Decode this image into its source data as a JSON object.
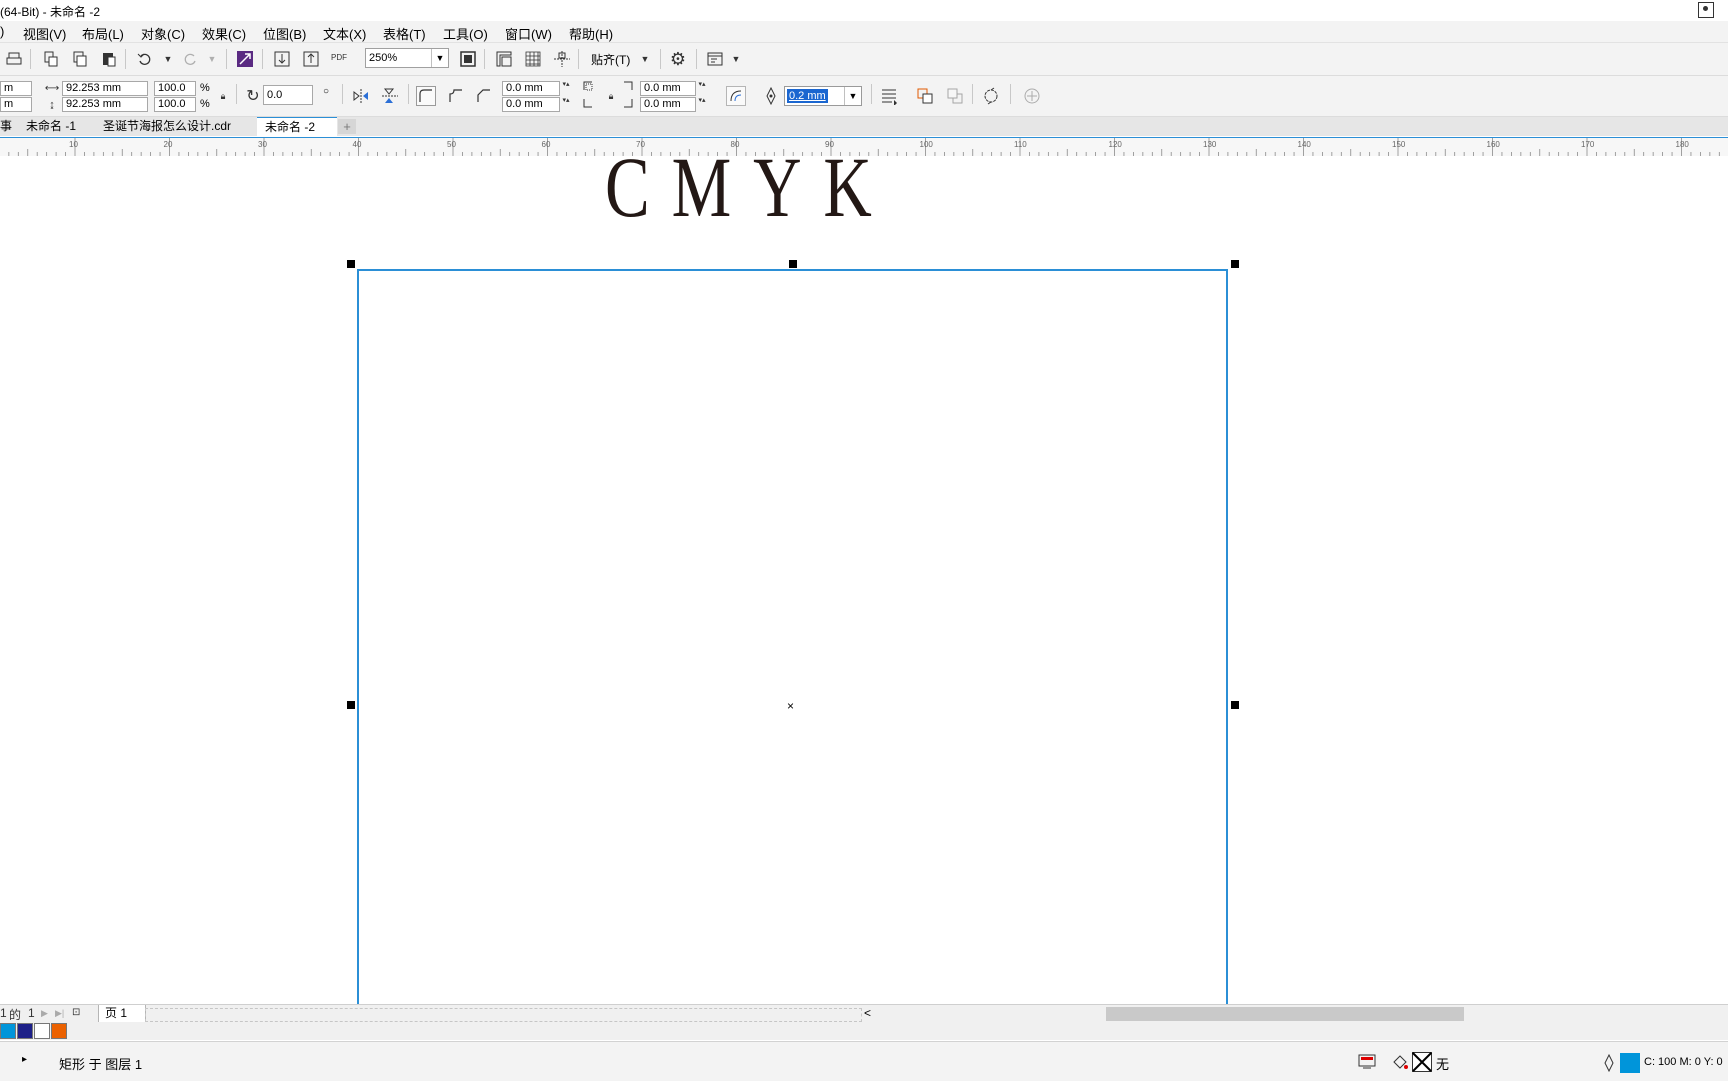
{
  "window": {
    "title": "(64-Bit) - 未命名 -2"
  },
  "menubar": {
    "edge_char": ")",
    "items": [
      {
        "label": "视图(V)"
      },
      {
        "label": "布局(L)"
      },
      {
        "label": "对象(C)"
      },
      {
        "label": "效果(C)"
      },
      {
        "label": "位图(B)"
      },
      {
        "label": "文本(X)"
      },
      {
        "label": "表格(T)"
      },
      {
        "label": "工具(O)"
      },
      {
        "label": "窗口(W)"
      },
      {
        "label": "帮助(H)"
      }
    ]
  },
  "toolbar": {
    "zoom_value": "250%",
    "pdf_label": "PDF",
    "snap_label": "贴齐(T)",
    "icons": [
      "print-icon",
      "cut-icon",
      "copy-icon",
      "paste-icon",
      "undo-icon",
      "redo-icon",
      "corel-connect-icon",
      "import-icon",
      "export-icon",
      "publish-pdf-icon",
      "full-screen-icon",
      "show-rulers-icon",
      "show-grid-icon",
      "show-guidelines-icon",
      "options-gear-icon",
      "app-launcher-icon"
    ]
  },
  "propbar": {
    "x_partial": "m",
    "y_partial": "m",
    "width_value": "92.253 mm",
    "height_value": "92.253 mm",
    "scale_x": "100.0",
    "scale_y": "100.0",
    "percent": "%",
    "rotation_value": "0.0",
    "degree_symbol": "○",
    "corner_top_left": "0.0 mm",
    "corner_bottom_left": "0.0 mm",
    "corner_top_right": "0.0 mm",
    "corner_bottom_right": "0.0 mm",
    "outline_width": "0.2 mm"
  },
  "doc_tabs": {
    "edge_char": "事",
    "tabs": [
      {
        "label": "未命名 -1",
        "active": false
      },
      {
        "label": "圣诞节海报怎么设计.cdr",
        "active": false
      },
      {
        "label": "未命名 -2",
        "active": true
      }
    ],
    "add_label": "+"
  },
  "ruler": {
    "labels": [
      "10",
      "20",
      "30",
      "40",
      "50",
      "60",
      "70",
      "80",
      "90",
      "100",
      "110",
      "120",
      "130",
      "140",
      "150",
      "160",
      "170",
      "180"
    ]
  },
  "canvas": {
    "heading_text": "CMYK"
  },
  "pagebar": {
    "page_counter_a": "1",
    "page_counter_of": "的",
    "page_counter_b": "1",
    "page_tab_label": "页 1",
    "scroll_left": "<"
  },
  "palette": {
    "colors": [
      "#0095da",
      "#1d2088",
      "#ffffff",
      "#eb6100"
    ]
  },
  "statusbar": {
    "arrow": "▸",
    "object_info": "矩形 于 图层 1",
    "fill_label": "无",
    "outline_info": "C: 100 M: 0 Y: 0",
    "outline_color": "#0095da"
  }
}
